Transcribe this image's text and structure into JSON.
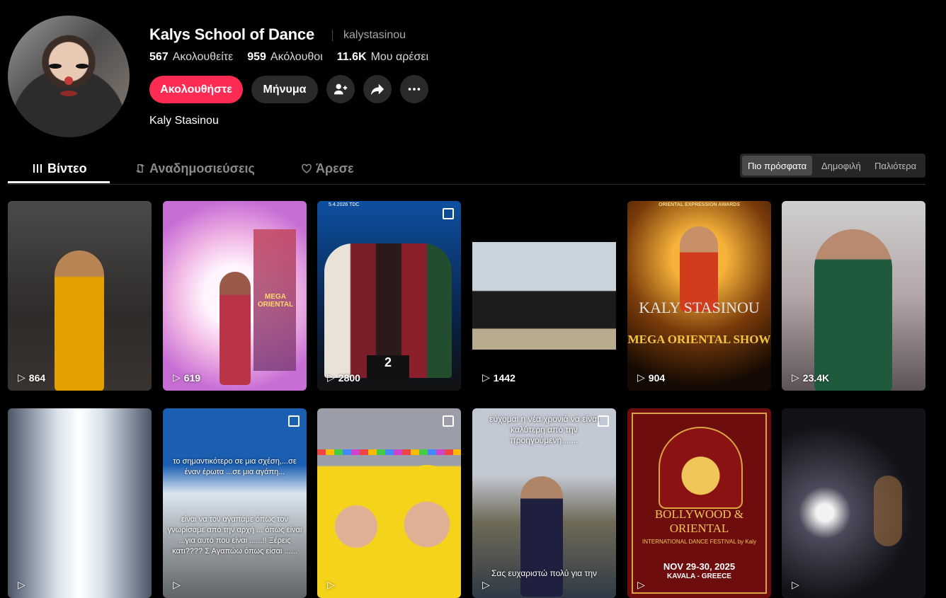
{
  "profile": {
    "display_name": "Kalys School of Dance",
    "handle": "kalystasinou",
    "bio": "Kaly Stasinou",
    "stats": [
      {
        "value": "567",
        "label": "Ακολουθείτε"
      },
      {
        "value": "959",
        "label": "Ακόλουθοι"
      },
      {
        "value": "11.6K",
        "label": "Μου αρέσει"
      }
    ],
    "follow_label": "Ακολουθήστε",
    "message_label": "Μήνυμα"
  },
  "tabs": [
    {
      "label": "Βίντεο",
      "icon": "grid-icon",
      "active": true
    },
    {
      "label": "Αναδημοσιεύσεις",
      "icon": "repost-icon",
      "active": false
    },
    {
      "label": "Άρεσε",
      "icon": "heart-icon",
      "active": false
    }
  ],
  "sort_options": [
    {
      "label": "Πιο πρόσφατα",
      "selected": true
    },
    {
      "label": "Δημοφιλή",
      "selected": false
    },
    {
      "label": "Παλιότερα",
      "selected": false
    }
  ],
  "colors": {
    "accent": "#fe2c55",
    "background": "#000000",
    "button": "#2a2a2a"
  },
  "videos": [
    {
      "views": "864"
    },
    {
      "views": "619",
      "overlay": "MEGA ORIENTAL"
    },
    {
      "views": "2800",
      "overlay": "5.4.2026 TDC",
      "badge": "2"
    },
    {
      "views": "1442"
    },
    {
      "views": "904",
      "overlay": "ORIENTAL EXPRESSION AWARDS",
      "title": "KALY STASINOU",
      "subtitle": "MEGA ORIENTAL SHOW"
    },
    {
      "views": "23.4K"
    },
    {
      "views": ""
    },
    {
      "views": "",
      "overlay": "το σημαντικότερο σε μια σχέση,...σε έναν έρωτα ...σε μια αγάπη...",
      "overlay2": "είναι να τον αγαπάμε όπως τον γνωρίσαμε από την αρχή ... όπως είναι ...για αυτό που είναι ......!! Ξέρεις κατι???? Σ Αγαπώω όπως είσαι ......"
    },
    {
      "views": ""
    },
    {
      "views": "",
      "overlay": "εύχομαι η νέα χρονιά να είναι καλύτερη από την προηγούμενη.......",
      "overlay2": "Σας ευχαριστώ πολύ για την"
    },
    {
      "views": "",
      "title": "BOLLYWOOD & ORIENTAL",
      "subtitle": "INTERNATIONAL DANCE FESTIVAL by Kaly",
      "date": "NOV 29-30, 2025",
      "place": "KAVALA - GREECE"
    },
    {
      "views": ""
    }
  ]
}
